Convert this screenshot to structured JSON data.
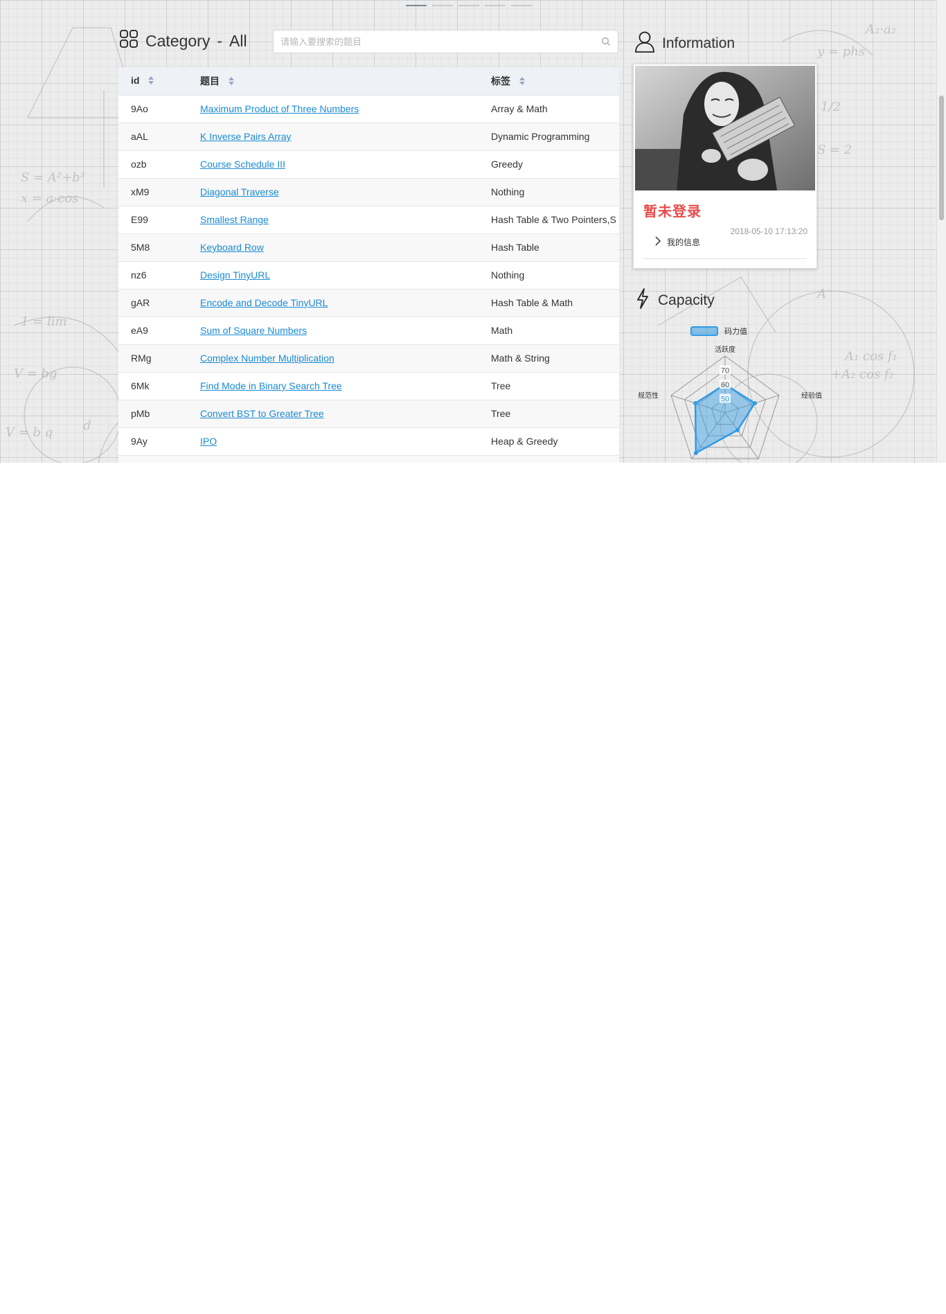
{
  "header": {
    "category_prefix": "Category",
    "category_separator": "-",
    "category_value": "All",
    "search_placeholder": "请输入要搜索的题目"
  },
  "table": {
    "columns": [
      "id",
      "题目",
      "标签"
    ],
    "rows": [
      {
        "id": "9Ao",
        "title": "Maximum Product of Three Numbers",
        "tags": "Array & Math"
      },
      {
        "id": "aAL",
        "title": "K Inverse Pairs Array",
        "tags": "Dynamic Programming"
      },
      {
        "id": "ozb",
        "title": "Course Schedule III",
        "tags": "Greedy"
      },
      {
        "id": "xM9",
        "title": "Diagonal Traverse",
        "tags": "Nothing"
      },
      {
        "id": "E99",
        "title": "Smallest Range",
        "tags": "Hash Table & Two Pointers,S"
      },
      {
        "id": "5M8",
        "title": "Keyboard Row",
        "tags": "Hash Table"
      },
      {
        "id": "nz6",
        "title": "Design TinyURL",
        "tags": "Nothing"
      },
      {
        "id": "gAR",
        "title": "Encode and Decode TinyURL",
        "tags": "Hash Table & Math"
      },
      {
        "id": "eA9",
        "title": "Sum of Square Numbers",
        "tags": "Math"
      },
      {
        "id": "RMg",
        "title": "Complex Number Multiplication",
        "tags": "Math & String"
      },
      {
        "id": "6Mk",
        "title": "Find Mode in Binary Search Tree",
        "tags": "Tree"
      },
      {
        "id": "pMb",
        "title": "Convert BST to Greater Tree",
        "tags": "Tree"
      },
      {
        "id": "9Ay",
        "title": "IPO",
        "tags": "Heap & Greedy"
      }
    ]
  },
  "info": {
    "title": "Information",
    "status": "暂未登录",
    "date": "2018-05-10 17:13:20",
    "my_info": "我的信息"
  },
  "capacity": {
    "title": "Capacity"
  },
  "chart_data": {
    "type": "radar",
    "legend": [
      "码力值"
    ],
    "indicators": [
      "活跃度",
      "经验值",
      "",
      "",
      "规范性"
    ],
    "radial_ticks": [
      50,
      60,
      70
    ],
    "values": [
      60,
      62,
      55,
      75,
      62
    ],
    "colors": {
      "series": "#2f9be6"
    }
  }
}
